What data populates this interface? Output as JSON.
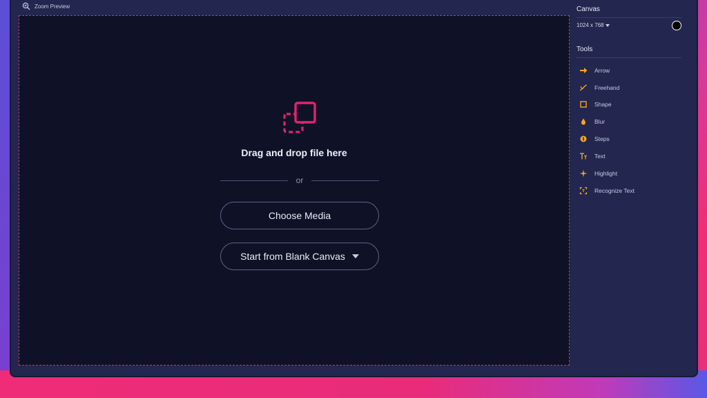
{
  "topbar": {
    "zoom_label": "Zoom Preview"
  },
  "dropzone": {
    "title": "Drag and drop file here",
    "or_text": "or",
    "choose_media_label": "Choose Media",
    "blank_canvas_label": "Start from Blank Canvas"
  },
  "sidebar": {
    "canvas_heading": "Canvas",
    "canvas_size": "1024 x 768",
    "canvas_color": "#000000",
    "tools_heading": "Tools",
    "tools": [
      {
        "label": "Arrow",
        "icon": "arrow-icon"
      },
      {
        "label": "Freehand",
        "icon": "freehand-icon"
      },
      {
        "label": "Shape",
        "icon": "shape-icon"
      },
      {
        "label": "Blur",
        "icon": "blur-icon"
      },
      {
        "label": "Steps",
        "icon": "steps-icon"
      },
      {
        "label": "Text",
        "icon": "text-icon"
      },
      {
        "label": "Highlight",
        "icon": "highlight-icon"
      },
      {
        "label": "Recognize Text",
        "icon": "recognize-text-icon"
      }
    ]
  },
  "colors": {
    "accent_pink": "#e0246f",
    "tool_icon": "#f5a623",
    "dropzone_bg": "#0f1226",
    "panel_bg": "#23264e"
  }
}
